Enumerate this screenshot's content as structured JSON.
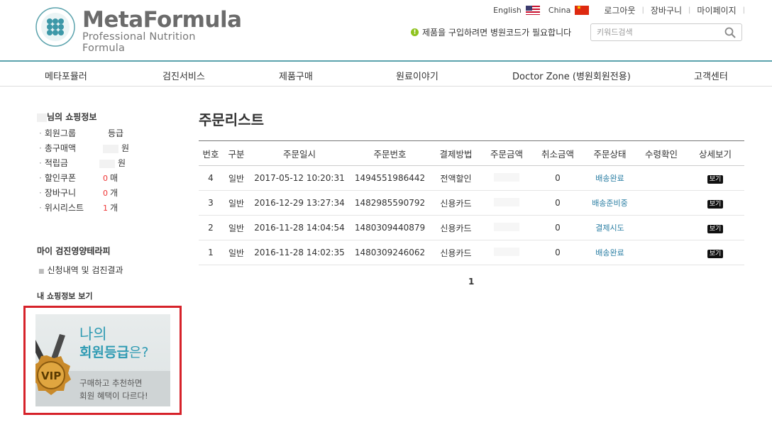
{
  "logo": {
    "title": "MetaFormula",
    "subtitle": "Professional Nutrition Formula"
  },
  "top_links": {
    "english": "English",
    "china": "China",
    "logout": "로그아웃",
    "cart": "장바구니",
    "mypage": "마이페이지"
  },
  "notice": {
    "icon": "!",
    "text": "제품을 구입하려면 병원코드가 필요합니다"
  },
  "search": {
    "placeholder": "키워드검색"
  },
  "nav": {
    "items": [
      "메타포뮬러",
      "검진서비스",
      "제품구매",
      "원료이야기",
      "Doctor Zone (병원회원전용)",
      "고객센터"
    ]
  },
  "sidebar": {
    "title_suffix": "님의 쇼핑정보",
    "rows": [
      {
        "label": "회원그룹",
        "value": "등급"
      },
      {
        "label": "총구매액",
        "value": "원"
      },
      {
        "label": "적립금",
        "value": "원"
      },
      {
        "label": "할인쿠폰",
        "count": "0",
        "unit": "매"
      },
      {
        "label": "장바구니",
        "count": "0",
        "unit": "개"
      },
      {
        "label": "위시리스트",
        "count": "1",
        "unit": "개"
      }
    ],
    "therapy_title": "마이 검진영양테라피",
    "therapy_link": "신청내역 및 검진결과",
    "myinfo_title": "내 쇼핑정보 보기",
    "banner": {
      "line1": "나의",
      "line2_bold": "회원등급",
      "line2_rest": "은?",
      "line3": "구매하고 추천하면",
      "line4": "회원 혜택이 다르다!",
      "medal_text": "VIP"
    }
  },
  "main": {
    "title": "주문리스트",
    "columns": [
      "번호",
      "구분",
      "주문일시",
      "주문번호",
      "결제방법",
      "주문금액",
      "취소금액",
      "주문상태",
      "수령확인",
      "상세보기"
    ],
    "rows": [
      {
        "no": "4",
        "type": "일반",
        "date": "2017-05-12 10:20:31",
        "order_no": "1494551986442",
        "pay": "전액할인",
        "amount": "",
        "cancel": "0",
        "status": "배송완료",
        "confirm": "",
        "detail": "보기"
      },
      {
        "no": "3",
        "type": "일반",
        "date": "2016-12-29 13:27:34",
        "order_no": "1482985590792",
        "pay": "신용카드",
        "amount": "",
        "cancel": "0",
        "status": "배송준비중",
        "confirm": "",
        "detail": "보기"
      },
      {
        "no": "2",
        "type": "일반",
        "date": "2016-11-28 14:04:54",
        "order_no": "1480309440879",
        "pay": "신용카드",
        "amount": "",
        "cancel": "0",
        "status": "결제시도",
        "confirm": "",
        "detail": "보기"
      },
      {
        "no": "1",
        "type": "일반",
        "date": "2016-11-28 14:02:35",
        "order_no": "1480309246062",
        "pay": "신용카드",
        "amount": "",
        "cancel": "0",
        "status": "배송완료",
        "confirm": "",
        "detail": "보기"
      }
    ],
    "pagination": [
      "1"
    ]
  },
  "colors": {
    "accent": "#5ba3ad",
    "status_link": "#2a7ea3",
    "banner_border": "#d6222a",
    "notice_icon": "#8fc31f"
  }
}
